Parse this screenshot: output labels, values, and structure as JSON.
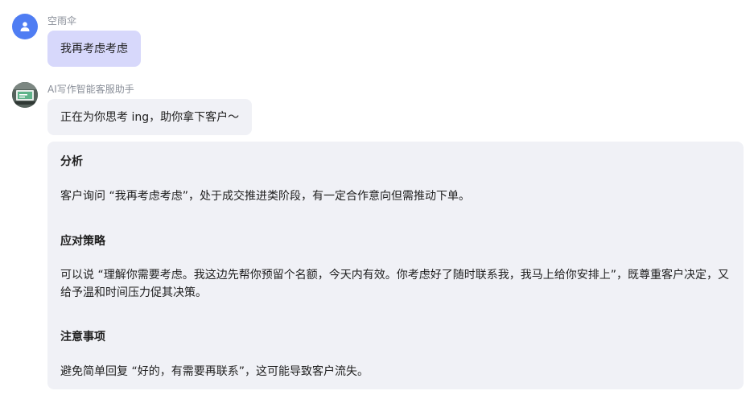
{
  "user": {
    "name": "空雨伞",
    "message": "我再考虑考虑"
  },
  "bot": {
    "name": "AI写作智能客服助手",
    "message": "正在为你思考 ing，助你拿下客户～",
    "sections": [
      {
        "heading": "分析",
        "text": "客户询问 “我再考虑考虑”，处于成交推进类阶段，有一定合作意向但需推动下单。"
      },
      {
        "heading": "应对策略",
        "text": "可以说 “理解你需要考虑。我这边先帮你预留个名额，今天内有效。你考虑好了随时联系我，我马上给你安排上”，既尊重客户决定，又给予温和时间压力促其决策。"
      },
      {
        "heading": "注意事项",
        "text": "避免简单回复 “好的，有需要再联系”，这可能导致客户流失。"
      }
    ]
  },
  "colors": {
    "user_avatar": "#4f7df3",
    "user_bubble": "#d7d8fb",
    "bot_bubble": "#f0f1f6"
  }
}
